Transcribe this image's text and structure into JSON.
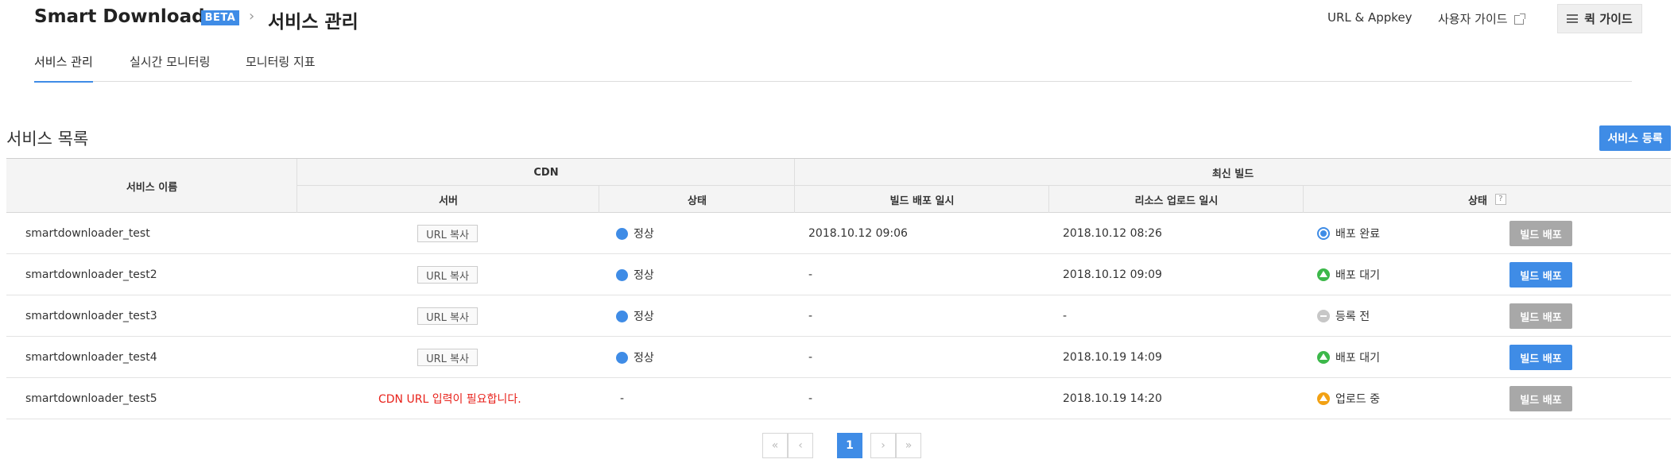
{
  "header": {
    "brand": "Smart Downloader",
    "beta": "BETA",
    "crumb_sep": "›",
    "title": "서비스 관리",
    "links": {
      "url_appkey": "URL & Appkey",
      "user_guide": "사용자 가이드"
    },
    "quick_guide": "퀵 가이드"
  },
  "tabs": [
    {
      "label": "서비스 관리",
      "active": true
    },
    {
      "label": "실시간 모니터링",
      "active": false
    },
    {
      "label": "모니터링 지표",
      "active": false
    }
  ],
  "section": {
    "title": "서비스 목록",
    "register_label": "서비스 등록"
  },
  "table": {
    "headers": {
      "name": "서비스 이름",
      "cdn": "CDN",
      "server": "서버",
      "cdn_status": "상태",
      "latest_build": "최신 빌드",
      "build_deploy_time": "빌드 배포 일시",
      "resource_upload_time": "리소스 업로드 일시",
      "build_status": "상태",
      "help": "?"
    },
    "rows": [
      {
        "name": "smartdownloader_test",
        "server": "URL 복사",
        "cdn_status": "정상",
        "deploy_time": "2018.10.12 09:06",
        "upload_time": "2018.10.12 08:26",
        "status": "배포 완료",
        "status_type": "done",
        "action": "빌드 배포",
        "action_enabled": false
      },
      {
        "name": "smartdownloader_test2",
        "server": "URL 복사",
        "cdn_status": "정상",
        "deploy_time": "-",
        "upload_time": "2018.10.12 09:09",
        "status": "배포 대기",
        "status_type": "wait",
        "action": "빌드 배포",
        "action_enabled": true
      },
      {
        "name": "smartdownloader_test3",
        "server": "URL 복사",
        "cdn_status": "정상",
        "deploy_time": "-",
        "upload_time": "-",
        "status": "등록 전",
        "status_type": "none",
        "action": "빌드 배포",
        "action_enabled": false
      },
      {
        "name": "smartdownloader_test4",
        "server": "URL 복사",
        "cdn_status": "정상",
        "deploy_time": "-",
        "upload_time": "2018.10.19 14:09",
        "status": "배포 대기",
        "status_type": "wait",
        "action": "빌드 배포",
        "action_enabled": true
      },
      {
        "name": "smartdownloader_test5",
        "server_error": "CDN URL 입력이 필요합니다.",
        "cdn_status_text": "-",
        "deploy_time": "-",
        "upload_time": "2018.10.19 14:20",
        "status": "업로드 중",
        "status_type": "up",
        "action": "빌드 배포",
        "action_enabled": false
      }
    ]
  },
  "pagination": {
    "first": "«",
    "prev": "‹",
    "current": "1",
    "next": "›",
    "last": "»"
  },
  "colors": {
    "accent": "#3f8ce6",
    "error": "#e8221b",
    "disabled": "#a8a8a8",
    "wait": "#3cb84a",
    "uploading": "#f2a114"
  }
}
